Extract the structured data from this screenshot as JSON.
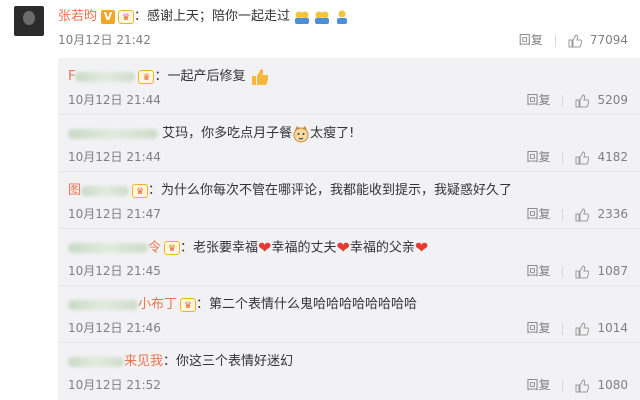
{
  "main_comment": {
    "username": "张若昀",
    "text": "：感谢上天；陪你一起走过",
    "date": "10月12日 21:42",
    "reply_label": "回复",
    "likes": "77094",
    "emojis": [
      "group-icon",
      "group-icon",
      "person-icon"
    ]
  },
  "replies": [
    {
      "name_visible": "F",
      "text": "：一起产后修复",
      "date": "10月12日 21:44",
      "reply_label": "回复",
      "likes": "5209"
    },
    {
      "name_visible": "",
      "text": "艾玛，你多吃点月子餐",
      "text_after": "太瘦了!",
      "date": "10月12日 21:44",
      "reply_label": "回复",
      "likes": "4182"
    },
    {
      "name_visible": "图",
      "text": "：为什么你每次不管在哪评论，我都能收到提示，我疑惑好久了",
      "date": "10月12日 21:47",
      "reply_label": "回复",
      "likes": "2336"
    },
    {
      "name_visible": "令",
      "text": "：老张要幸福",
      "text_2": "幸福的丈夫",
      "text_3": "幸福的父亲",
      "date": "10月12日 21:45",
      "reply_label": "回复",
      "likes": "1087"
    },
    {
      "name_visible": "小布丁",
      "text": "：第二个表情什么鬼哈哈哈哈哈哈哈哈",
      "date": "10月12日 21:46",
      "reply_label": "回复",
      "likes": "1014"
    },
    {
      "name_visible": "来见我",
      "text": "：你这三个表情好迷幻",
      "date": "10月12日 21:52",
      "reply_label": "回复",
      "likes": "1080"
    }
  ],
  "colors": {
    "name": "#eb7350",
    "meta": "#808080",
    "panel": "#f2f2f5"
  }
}
